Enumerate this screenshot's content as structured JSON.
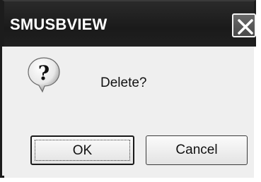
{
  "window": {
    "title": "SMUSBVIEW",
    "close_icon": "close-icon"
  },
  "dialog": {
    "icon": "question-icon",
    "message": "Delete?"
  },
  "buttons": {
    "ok_label": "OK",
    "cancel_label": "Cancel"
  }
}
